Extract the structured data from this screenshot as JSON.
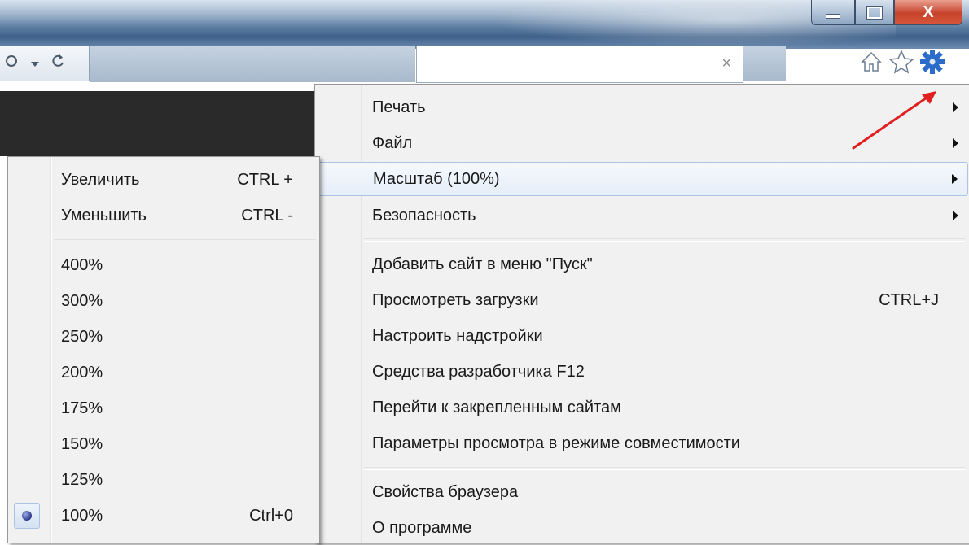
{
  "window": {
    "close_glyph": "X"
  },
  "toolbar": {
    "nav_icons": [
      "search-icon",
      "dropdown-icon",
      "refresh-icon"
    ],
    "search_clear_glyph": "×",
    "right_icons": [
      "home-icon",
      "favorites-icon",
      "gear-icon"
    ],
    "accent_color": "#2b6bc9"
  },
  "main_menu": {
    "items": [
      {
        "label": "Печать",
        "has_submenu": true
      },
      {
        "label": "Файл",
        "has_submenu": true
      },
      {
        "label": "Масштаб (100%)",
        "has_submenu": true,
        "highlighted": true
      },
      {
        "label": "Безопасность",
        "has_submenu": true
      },
      {
        "label": "Добавить сайт в меню \"Пуск\""
      },
      {
        "label": "Просмотреть загрузки",
        "shortcut": "CTRL+J"
      },
      {
        "label": "Настроить надстройки"
      },
      {
        "label": "Средства разработчика F12"
      },
      {
        "label": "Перейти к закрепленным сайтам"
      },
      {
        "label": "Параметры просмотра в режиме совместимости"
      },
      {
        "label": "Свойства браузера"
      },
      {
        "label": "О программе"
      }
    ]
  },
  "zoom_menu": {
    "items": [
      {
        "label": "Увеличить",
        "shortcut": "CTRL +"
      },
      {
        "label": "Уменьшить",
        "shortcut": "CTRL -"
      },
      {
        "label": "400%"
      },
      {
        "label": "300%"
      },
      {
        "label": "250%"
      },
      {
        "label": "200%"
      },
      {
        "label": "175%"
      },
      {
        "label": "150%"
      },
      {
        "label": "125%"
      },
      {
        "label": "100%",
        "shortcut": "Ctrl+0",
        "selected": true
      }
    ]
  },
  "annotation": {
    "arrow_color": "#e02020"
  }
}
